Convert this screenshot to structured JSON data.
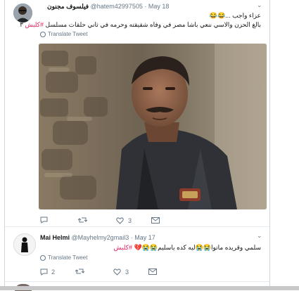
{
  "tweets": [
    {
      "name": "فيلسوف مجنون",
      "handle": "@hatem42997505",
      "date": "May 18",
      "text_line1": "عزاء واجب ...😂😂",
      "text_line2": "بالغ الحزن والاسي ننعي باشا مصر في وفاه شقيقته وحرمه في ثاني حلقات مسلسل",
      "hashtag": "#كلبش",
      "text_suffix": "٣",
      "translate": "Translate Tweet",
      "likes": "3"
    },
    {
      "name": "Mai Helmi",
      "handle": "@Mayhelmy2gmail3",
      "date": "May 17",
      "text": "سلمي وقريده ماتوا😭😭ليه كده ياسليم😭😭💔",
      "hashtag": "#كلبش",
      "translate": "Translate Tweet",
      "replies": "2",
      "likes": "3"
    }
  ],
  "icons": {
    "reply": "reply-icon",
    "retweet": "retweet-icon",
    "like": "heart-icon",
    "dm": "envelope-icon",
    "chevron": "chevron-down-icon",
    "globe": "globe-icon"
  },
  "colors": {
    "hashtag": "#e0245e",
    "secondary_text": "#657786"
  }
}
